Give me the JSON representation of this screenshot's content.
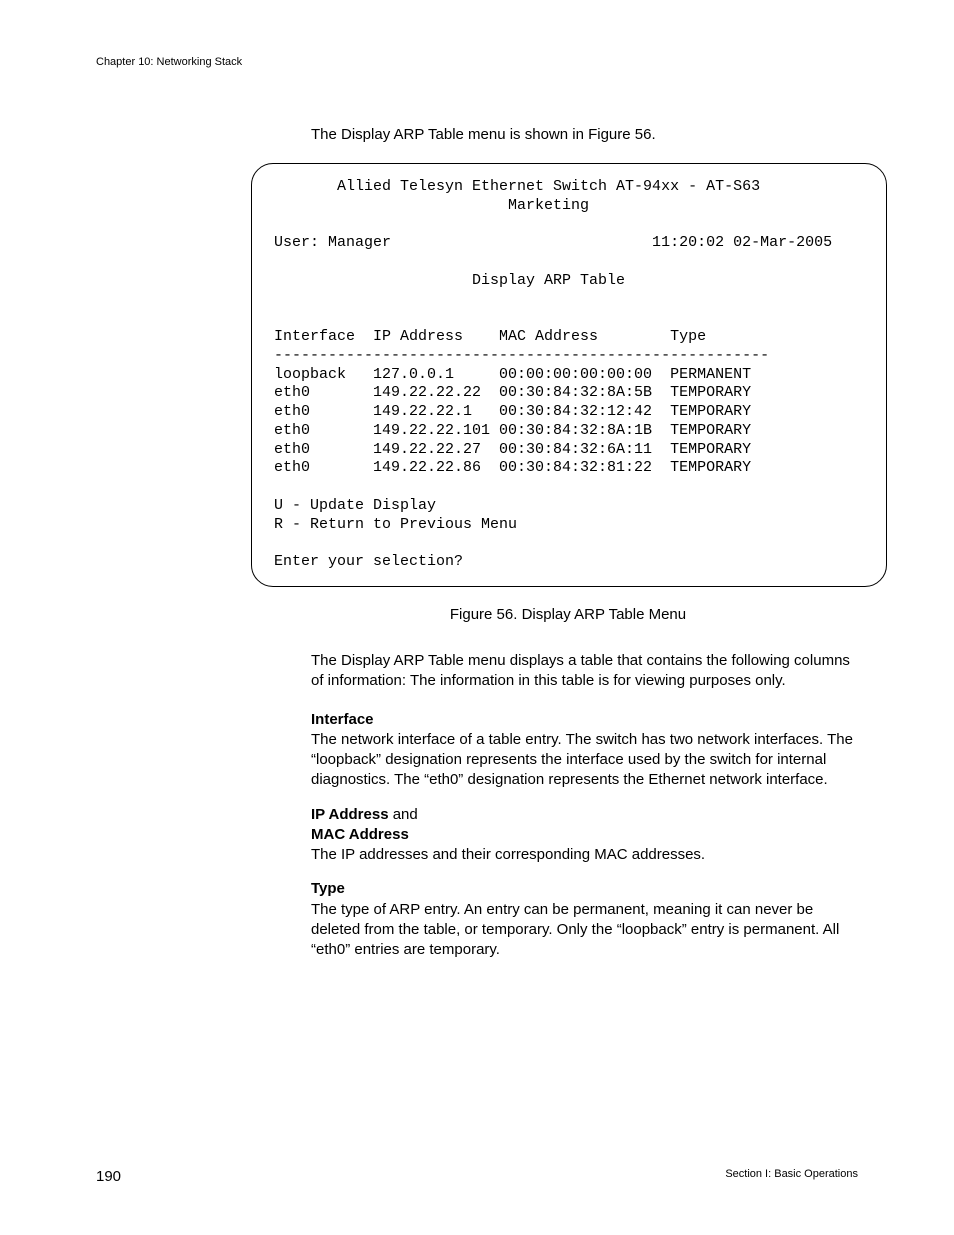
{
  "header": {
    "running": "Chapter 10: Networking Stack"
  },
  "intro": "The Display ARP Table menu is shown in Figure 56.",
  "terminal": {
    "title1": "Allied Telesyn Ethernet Switch AT-94xx - AT-S63",
    "title2": "Marketing",
    "userLabel": "User: Manager",
    "datetime": "11:20:02 02-Mar-2005",
    "screenTitle": "Display ARP Table",
    "cols": {
      "c1": "Interface",
      "c2": "IP Address",
      "c3": "MAC Address",
      "c4": "Type"
    },
    "divider": "-------------------------------------------------------",
    "rows": [
      {
        "iface": "loopback",
        "ip": "127.0.0.1",
        "mac": "00:00:00:00:00:00",
        "type": "PERMANENT"
      },
      {
        "iface": "eth0",
        "ip": "149.22.22.22",
        "mac": "00:30:84:32:8A:5B",
        "type": "TEMPORARY"
      },
      {
        "iface": "eth0",
        "ip": "149.22.22.1",
        "mac": "00:30:84:32:12:42",
        "type": "TEMPORARY"
      },
      {
        "iface": "eth0",
        "ip": "149.22.22.101",
        "mac": "00:30:84:32:8A:1B",
        "type": "TEMPORARY"
      },
      {
        "iface": "eth0",
        "ip": "149.22.22.27",
        "mac": "00:30:84:32:6A:11",
        "type": "TEMPORARY"
      },
      {
        "iface": "eth0",
        "ip": "149.22.22.86",
        "mac": "00:30:84:32:81:22",
        "type": "TEMPORARY"
      }
    ],
    "optU": "U - Update Display",
    "optR": "R - Return to Previous Menu",
    "prompt": "Enter your selection?"
  },
  "figCaption": "Figure 56. Display ARP Table Menu",
  "descPara": "The Display ARP Table menu displays a table that contains the following columns of information: The information in this table is for viewing purposes only.",
  "defs": {
    "iface": {
      "term": "Interface",
      "body": "The network interface of a table entry. The switch has two network interfaces. The “loopback” designation represents the interface used by the switch for internal diagnostics. The “eth0” designation represents the Ethernet network interface."
    },
    "ipmac": {
      "term1": "IP Address",
      "and": " and",
      "term2": "MAC Address",
      "body": "The IP addresses and their corresponding MAC addresses."
    },
    "type": {
      "term": "Type",
      "body": "The type of ARP entry. An entry can be permanent, meaning it can never be deleted from the table, or temporary. Only the “loopback” entry is permanent. All “eth0” entries are temporary."
    }
  },
  "footer": {
    "page": "190",
    "section": "Section I: Basic Operations"
  }
}
